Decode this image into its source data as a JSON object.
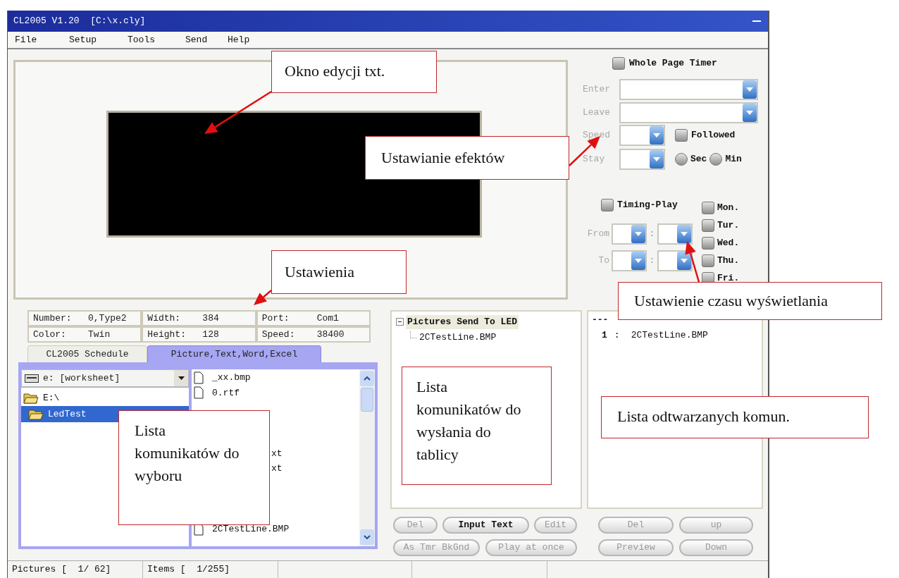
{
  "window": {
    "title": "CL2005 V1.20  [C:\\x.cly]"
  },
  "menu": [
    "File",
    "Setup",
    "Tools",
    "Send",
    "Help"
  ],
  "effects": {
    "whole_page_timer": {
      "label": "Whole Page Timer",
      "checked": false
    },
    "fields": [
      {
        "label": "Enter",
        "kind": "wide",
        "disabled": true
      },
      {
        "label": "Leave",
        "kind": "wide",
        "disabled": true
      },
      {
        "label": "Speed",
        "kind": "narrow",
        "disabled": true
      },
      {
        "label": "Stay",
        "kind": "narrow",
        "disabled": true
      }
    ],
    "followed": {
      "label": "Followed",
      "checked": false
    },
    "units": [
      {
        "label": "Sec",
        "selected": false
      },
      {
        "label": "Min",
        "selected": false
      }
    ]
  },
  "timing": {
    "label": "Timing-Play",
    "checked": false,
    "rows": [
      {
        "label": "From",
        "separator": ":",
        "disabled": true
      },
      {
        "label": "To",
        "separator": ":",
        "disabled": true
      }
    ],
    "days": [
      {
        "label": "Mon.",
        "checked": false
      },
      {
        "label": "Tur.",
        "checked": false
      },
      {
        "label": "Wed.",
        "checked": false
      },
      {
        "label": "Thu.",
        "checked": false
      },
      {
        "label": "Fri.",
        "checked": false
      }
    ]
  },
  "info": [
    [
      {
        "label": "Number:",
        "value": "0,Type2"
      },
      {
        "label": "Width:",
        "value": "384"
      },
      {
        "label": "Port:",
        "value": "Com1"
      }
    ],
    [
      {
        "label": "Color:",
        "value": "Twin"
      },
      {
        "label": "Height:",
        "value": "128"
      },
      {
        "label": "Speed:",
        "value": "38400"
      }
    ]
  ],
  "tabs": [
    {
      "label": "CL2005 Schedule",
      "selected": false
    },
    {
      "label": "Picture,Text,Word,Excel",
      "selected": true
    }
  ],
  "drive": {
    "value": "e: [worksheet]"
  },
  "folders": [
    {
      "label": "E:\\",
      "selected": false,
      "children": [
        {
          "label": "LedTest",
          "selected": true
        }
      ]
    }
  ],
  "files": [
    {
      "kind": "file",
      "name": "_xx.bmp"
    },
    {
      "kind": "file",
      "name": "0.rtf"
    },
    {
      "kind": "covered"
    },
    {
      "kind": "covered"
    },
    {
      "kind": "covered"
    },
    {
      "kind": "covered",
      "name": "xt"
    },
    {
      "kind": "covered",
      "name": "xt"
    },
    {
      "kind": "covered"
    },
    {
      "kind": "covered"
    },
    {
      "kind": "covered"
    },
    {
      "kind": "file",
      "name": "2CTestLine.BMP"
    }
  ],
  "send_list": {
    "label": "Pictures Send To LED",
    "expanded": true,
    "children": [
      {
        "label": "2CTestLine.BMP"
      }
    ]
  },
  "play_list": {
    "header": "---",
    "items": [
      {
        "index": "1",
        "separator": ":",
        "name": "2CTestLine.BMP"
      }
    ]
  },
  "send_buttons": [
    [
      {
        "label": "Del",
        "disabled": true
      },
      {
        "label": "Input Text",
        "disabled": false
      },
      {
        "label": "Edit",
        "disabled": true
      }
    ],
    [
      {
        "label": "As Tmr BkGnd",
        "disabled": true
      },
      {
        "label": "Play at once",
        "disabled": true
      }
    ]
  ],
  "play_buttons": [
    [
      {
        "label": "Del",
        "disabled": true
      },
      {
        "label": "up",
        "disabled": true
      }
    ],
    [
      {
        "label": "Preview",
        "disabled": true
      },
      {
        "label": "Down",
        "disabled": true
      }
    ]
  ],
  "status_bar": [
    "Pictures [  1/ 62]",
    "Items [  1/255]"
  ],
  "callouts": [
    {
      "text": "Okno edycji txt."
    },
    {
      "text": "Ustawianie efektów"
    },
    {
      "text": "Ustawienia"
    },
    {
      "text": "Ustawienie czasu wyświetlania"
    },
    {
      "text": "Lista komunikatów do wysłania do tablicy"
    },
    {
      "text": "Lista odtwarzanych komun."
    },
    {
      "text": "Lista komunikatów do wyboru"
    }
  ]
}
